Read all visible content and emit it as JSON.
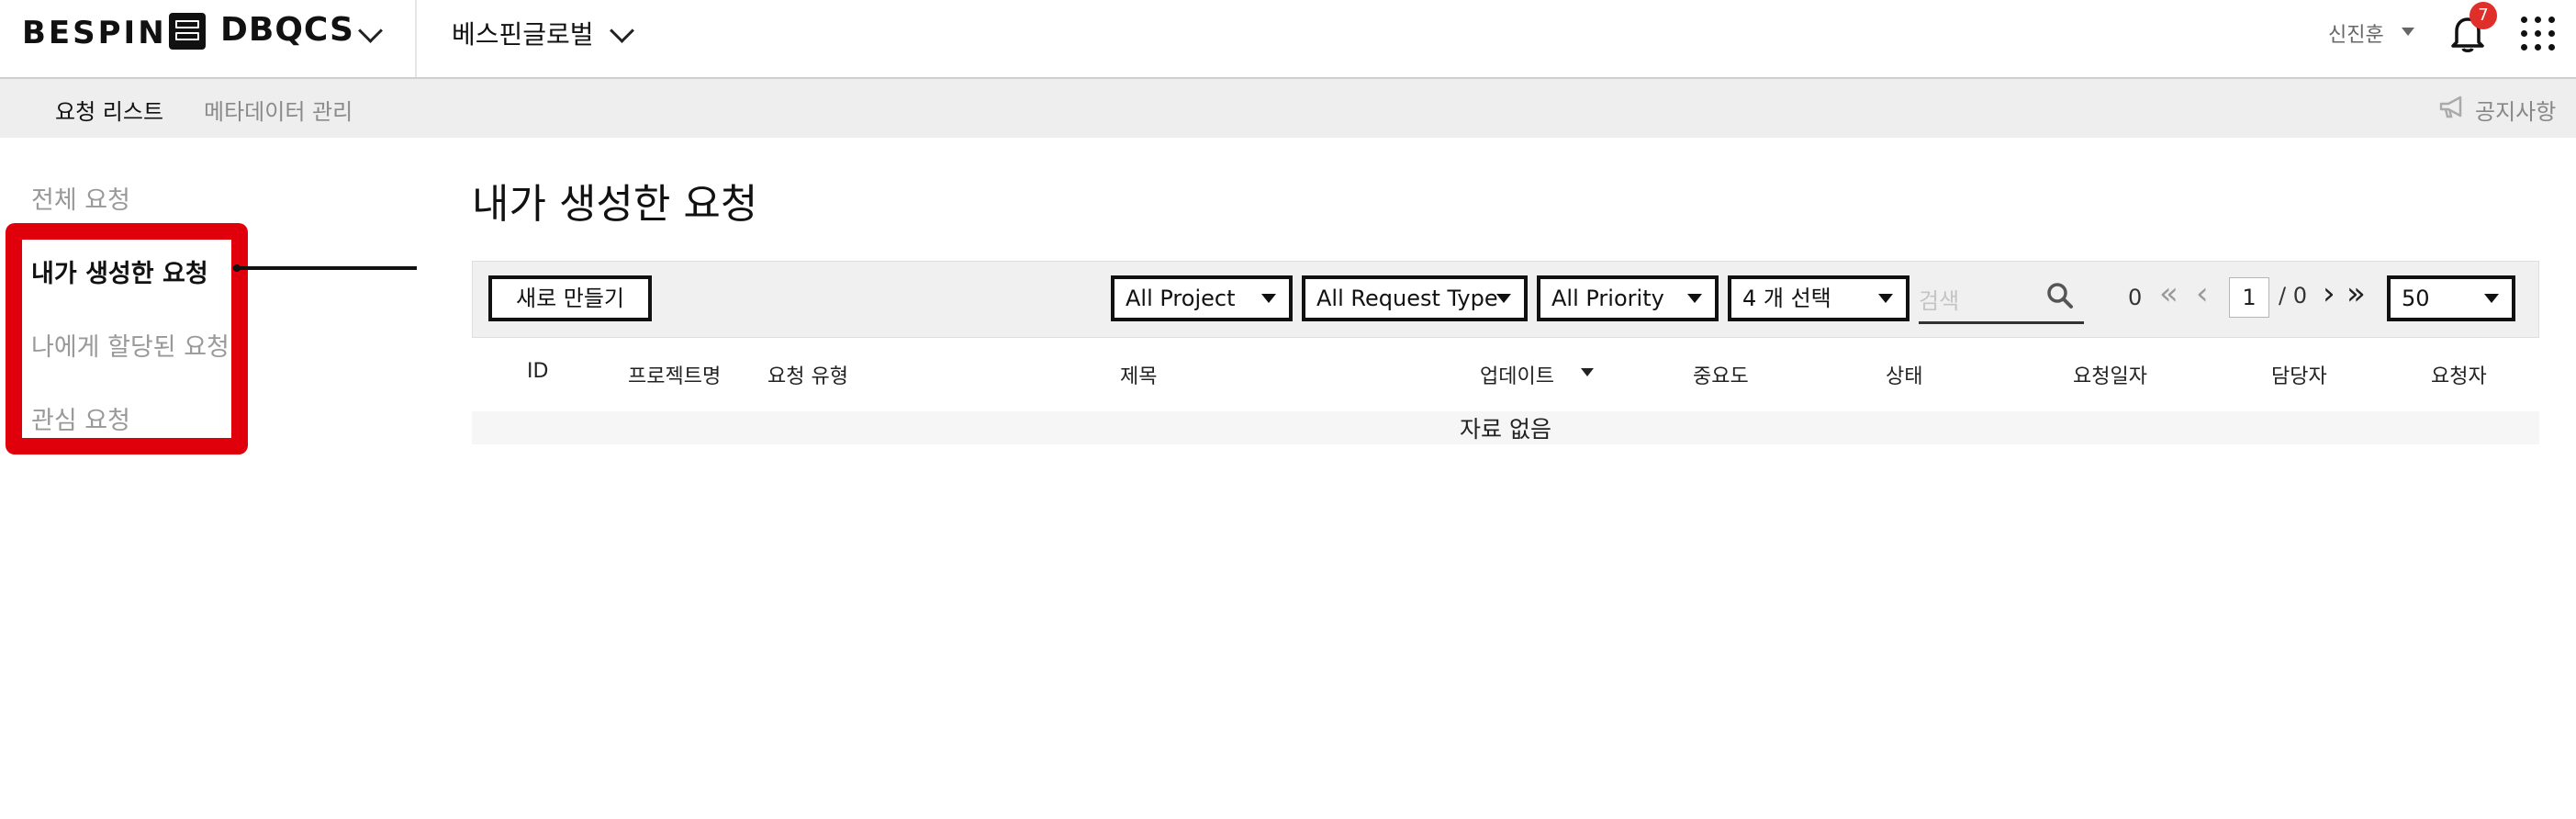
{
  "header": {
    "brand": "BESPIN",
    "app_name": "DBQCS",
    "org_name": "베스핀글로벌",
    "user_name": "신진훈",
    "notification_count": "7"
  },
  "subnav": {
    "items": [
      "요청 리스트",
      "메타데이터 관리"
    ],
    "notice": "공지사항"
  },
  "sidebar": {
    "items": [
      "전체 요청",
      "내가 생성한 요청",
      "나에게 할당된 요청",
      "관심 요청"
    ],
    "active_index": 1,
    "highlight_color": "#e0000b"
  },
  "main": {
    "title": "내가 생성한 요청",
    "create_button": "새로 만들기",
    "filters": {
      "project": "All Project",
      "request_type": "All Request Type",
      "priority": "All Priority",
      "status": "4 개 선택"
    },
    "search_placeholder": "검색",
    "pagination": {
      "total": "0",
      "current_page": "1",
      "total_pages": "/ 0",
      "page_size": "50"
    },
    "table": {
      "columns": [
        "ID",
        "프로젝트명",
        "요청 유형",
        "제목",
        "업데이트",
        "중요도",
        "상태",
        "요청일자",
        "담당자",
        "요청자"
      ],
      "empty_text": "자료 없음"
    }
  }
}
